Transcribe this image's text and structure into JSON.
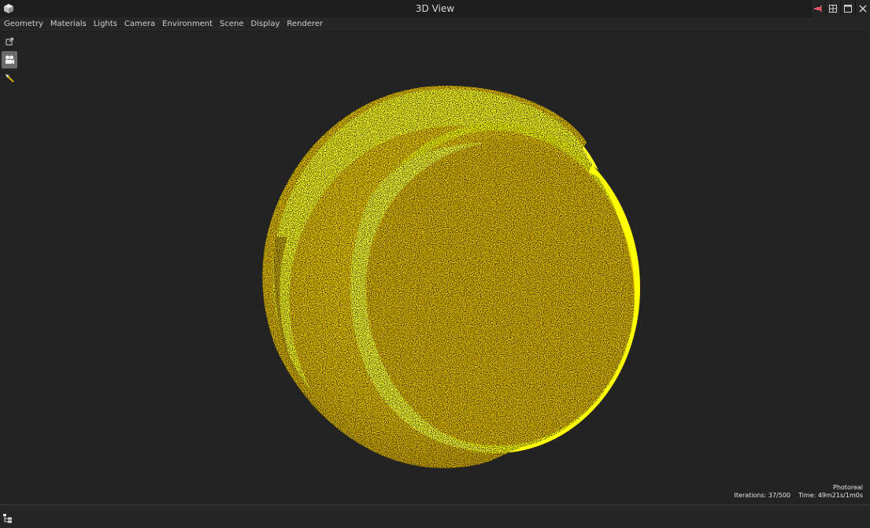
{
  "window": {
    "title": "3D View",
    "icons": [
      "cube-icon",
      "pin-icon",
      "layout-icon",
      "maximize-icon",
      "close-icon"
    ]
  },
  "menu": {
    "items": [
      "Geometry",
      "Materials",
      "Lights",
      "Camera",
      "Environment",
      "Scene",
      "Display",
      "Renderer"
    ]
  },
  "toolbox": {
    "icons": [
      "export-icon",
      "camera-icon",
      "picker-icon"
    ]
  },
  "viewport": {
    "status": {
      "mode": "Photoreal",
      "iterations": "Iterations: 37/500",
      "time": "Time: 49m21s/1m0s"
    }
  },
  "colors": {
    "object": "#ffff00",
    "background": "#232323",
    "chrome": "#1e1e1e"
  },
  "bottombar": {
    "icons": [
      "scene-tree-icon"
    ]
  }
}
